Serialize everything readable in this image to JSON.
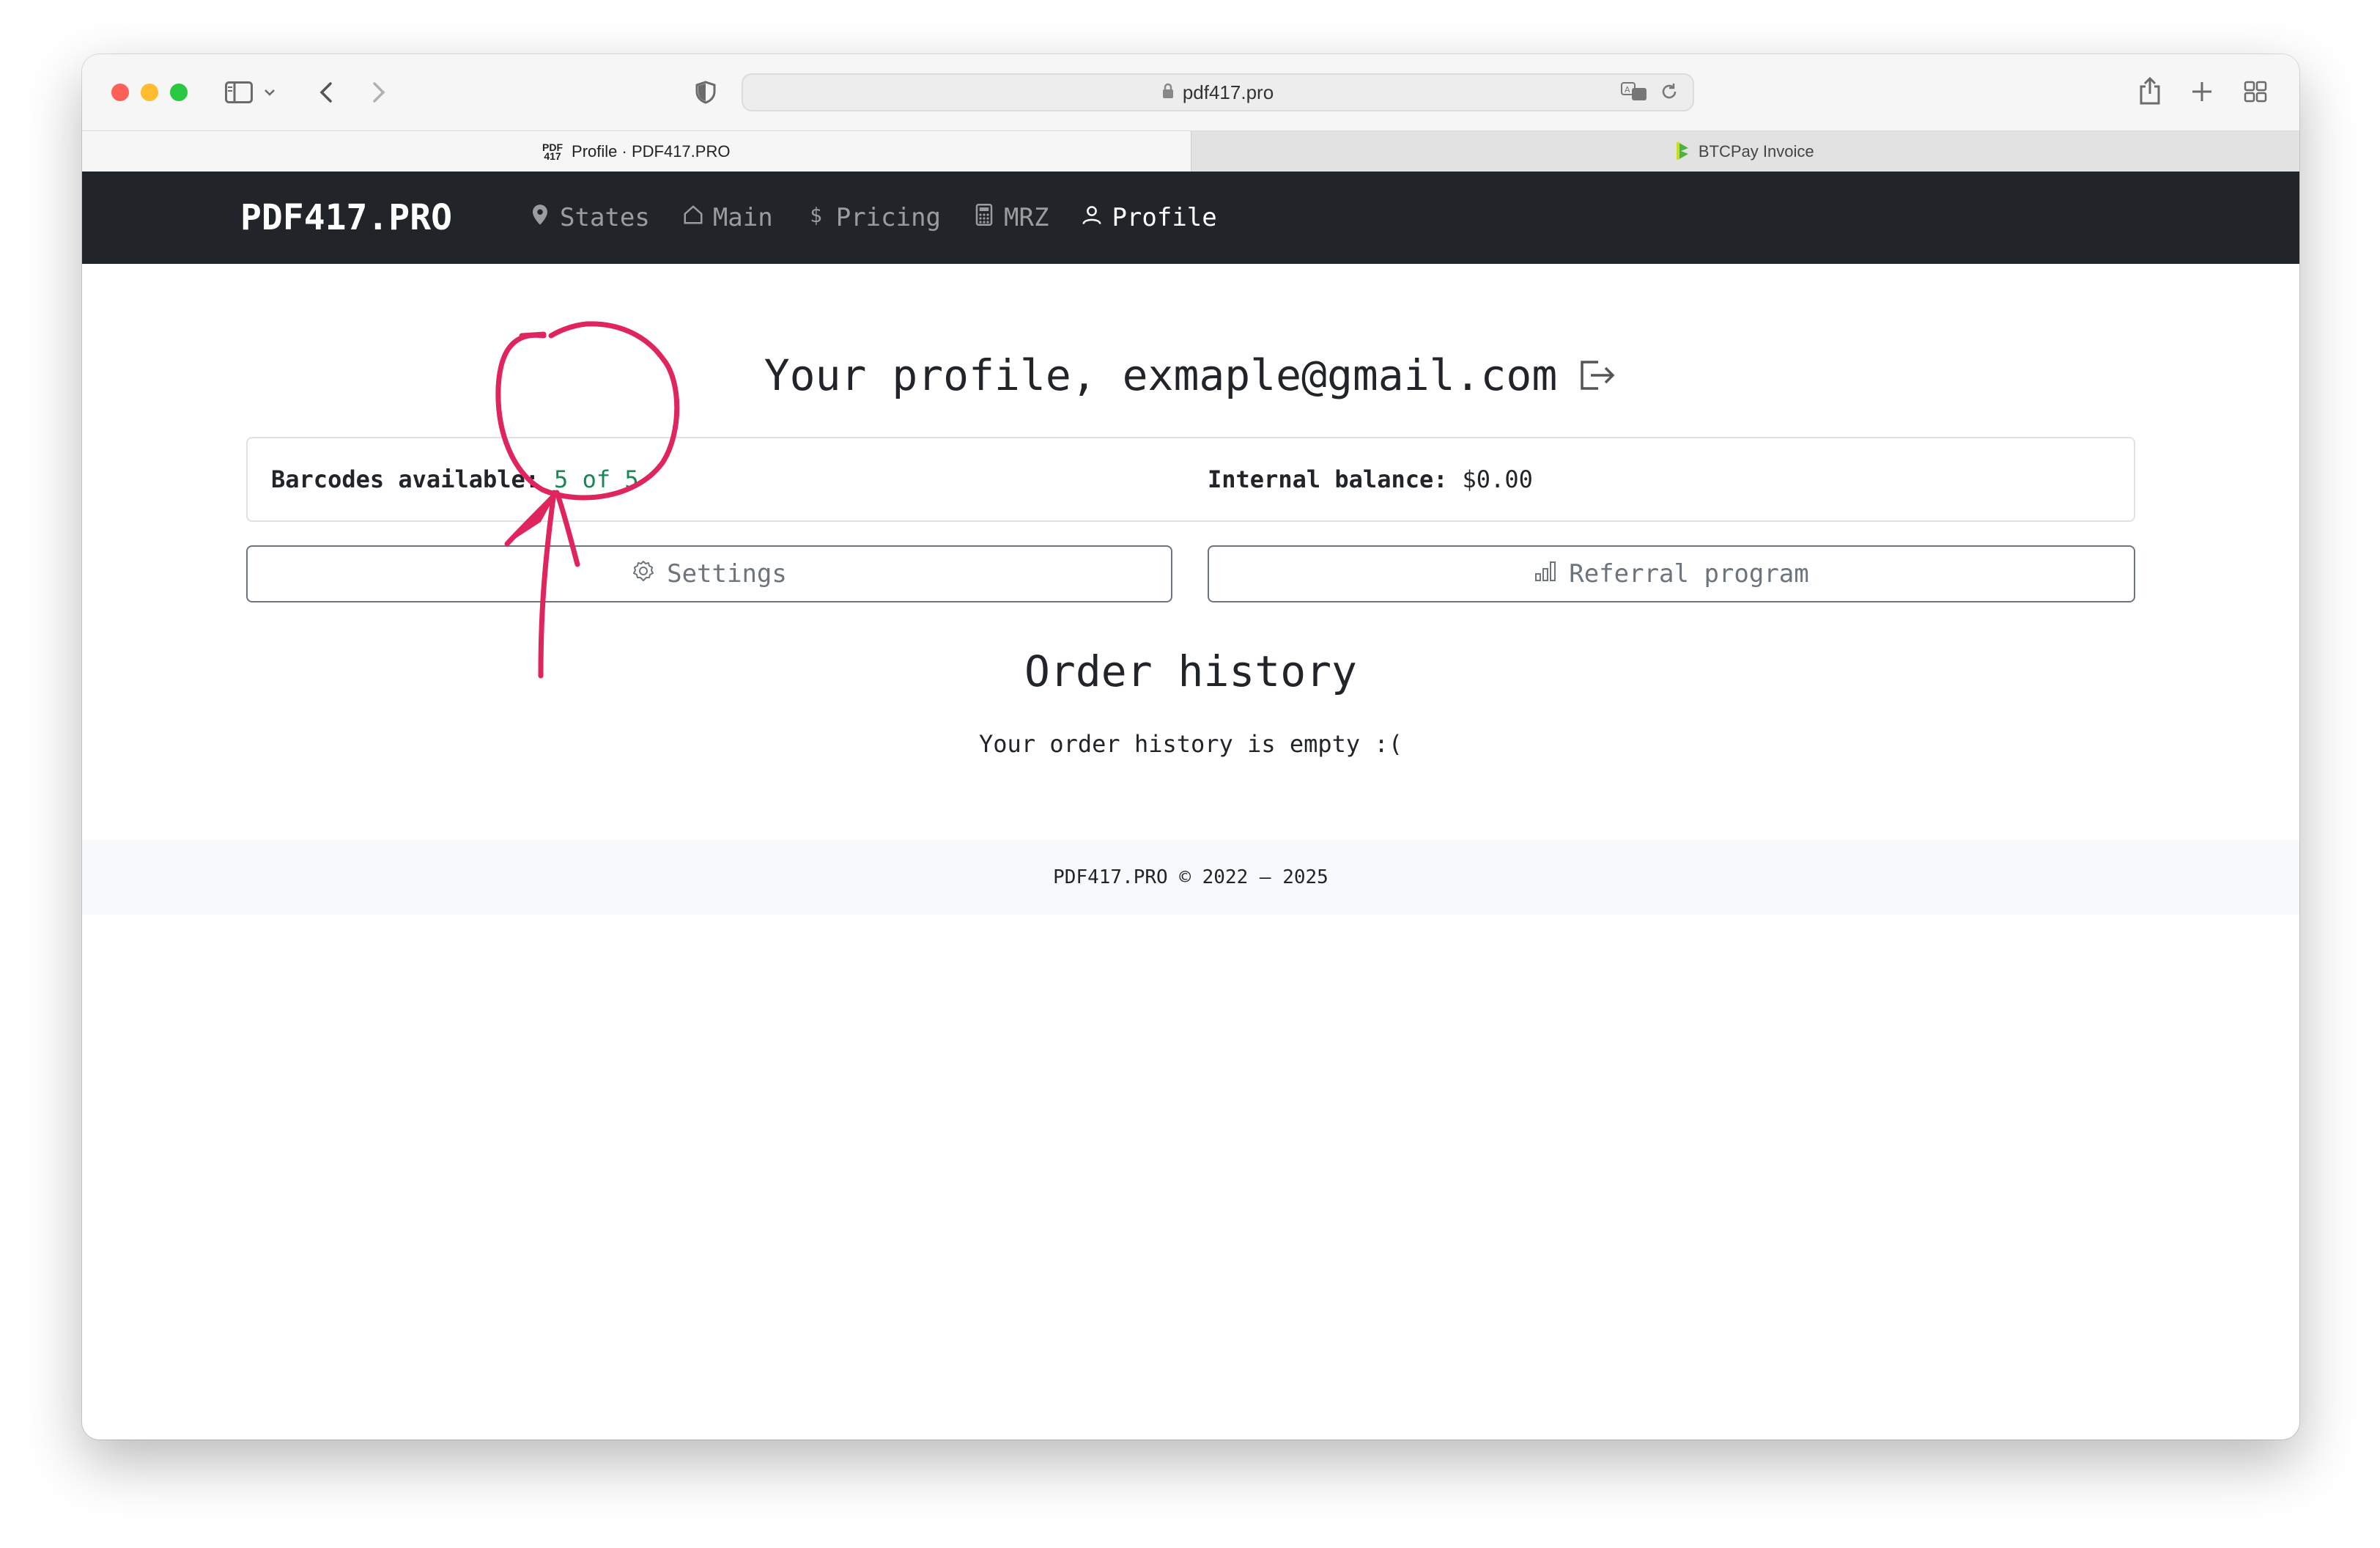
{
  "browser": {
    "url": "pdf417.pro",
    "tabs": [
      {
        "label": "Profile · PDF417.PRO",
        "favicon_text": "PDF\n417",
        "active": true
      },
      {
        "label": "BTCPay Invoice",
        "active": false
      }
    ]
  },
  "navbar": {
    "brand": "PDF417.PRO",
    "items": [
      {
        "label": "States",
        "icon": "map-pin-icon"
      },
      {
        "label": "Main",
        "icon": "home-icon"
      },
      {
        "label": "Pricing",
        "icon": "dollar-icon"
      },
      {
        "label": "MRZ",
        "icon": "calculator-icon"
      },
      {
        "label": "Profile",
        "icon": "user-icon",
        "active": true
      }
    ]
  },
  "profile": {
    "title": "Your profile, exmaple@gmail.com",
    "barcodes_label": "Barcodes available:",
    "barcodes_value": "5 of 5",
    "balance_label": "Internal balance:",
    "balance_value": "$0.00"
  },
  "buttons": {
    "settings": "Settings",
    "referral": "Referral program"
  },
  "orders": {
    "title": "Order history",
    "empty": "Your order history is empty :("
  },
  "footer": {
    "text": "PDF417.PRO © 2022 – 2025"
  },
  "colors": {
    "navbar_bg": "#212529",
    "success_green": "#198754",
    "annotation_red": "#e0245e"
  }
}
